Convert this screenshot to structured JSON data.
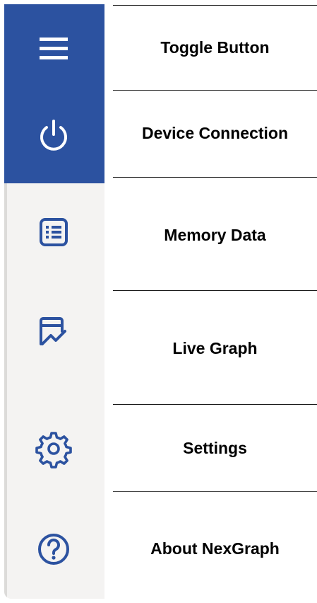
{
  "nav": {
    "items": [
      {
        "key": "toggle",
        "label": "Toggle Button",
        "icon": "hamburger-menu-icon"
      },
      {
        "key": "device",
        "label": "Device Connection",
        "icon": "power-icon"
      },
      {
        "key": "memory",
        "label": "Memory Data",
        "icon": "list-document-icon"
      },
      {
        "key": "graph",
        "label": "Live Graph",
        "icon": "line-chart-icon"
      },
      {
        "key": "settings",
        "label": "Settings",
        "icon": "gear-icon"
      },
      {
        "key": "about",
        "label": "About NexGraph",
        "icon": "help-icon"
      }
    ]
  },
  "colors": {
    "accent": "#2c52a0",
    "sidebar_bg": "#f4f3f2",
    "icon_blue": "#2c52a0",
    "icon_white": "#ffffff"
  }
}
